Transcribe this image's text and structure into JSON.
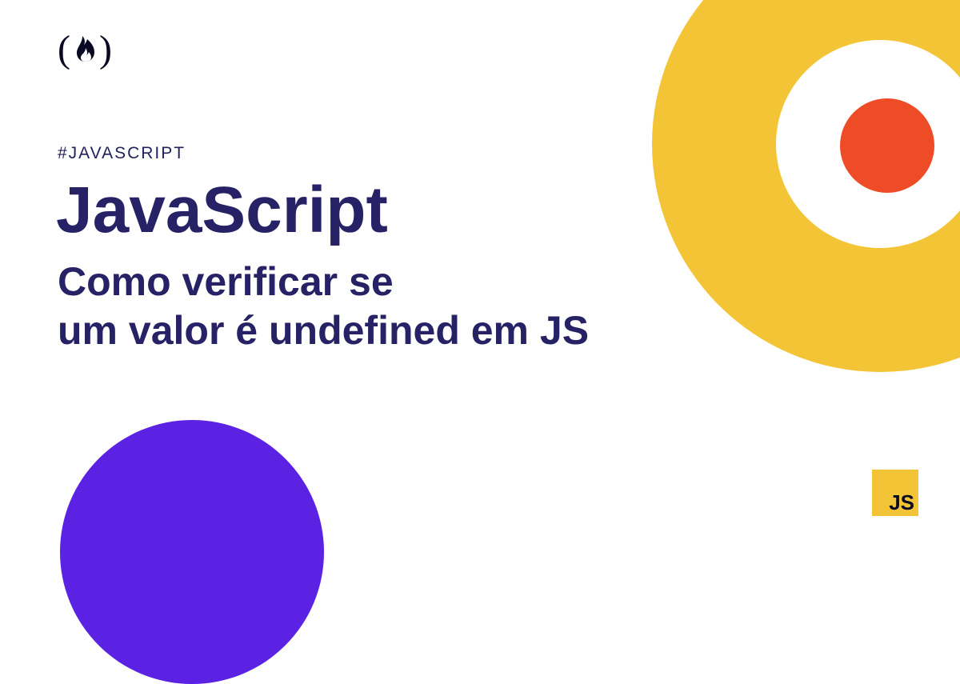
{
  "colors": {
    "yellow": "#f3c435",
    "red": "#ee4b27",
    "purple": "#5b22e3",
    "navy": "#272266",
    "ink": "#0a0923"
  },
  "logo": {
    "left_paren": "(",
    "flame": "🔥",
    "right_paren": ")"
  },
  "tag": "#JAVASCRIPT",
  "title": "JavaScript",
  "subtitle_line1": "Como verificar se",
  "subtitle_line2": "um valor é undefined em JS",
  "badge": {
    "label": "JS"
  }
}
